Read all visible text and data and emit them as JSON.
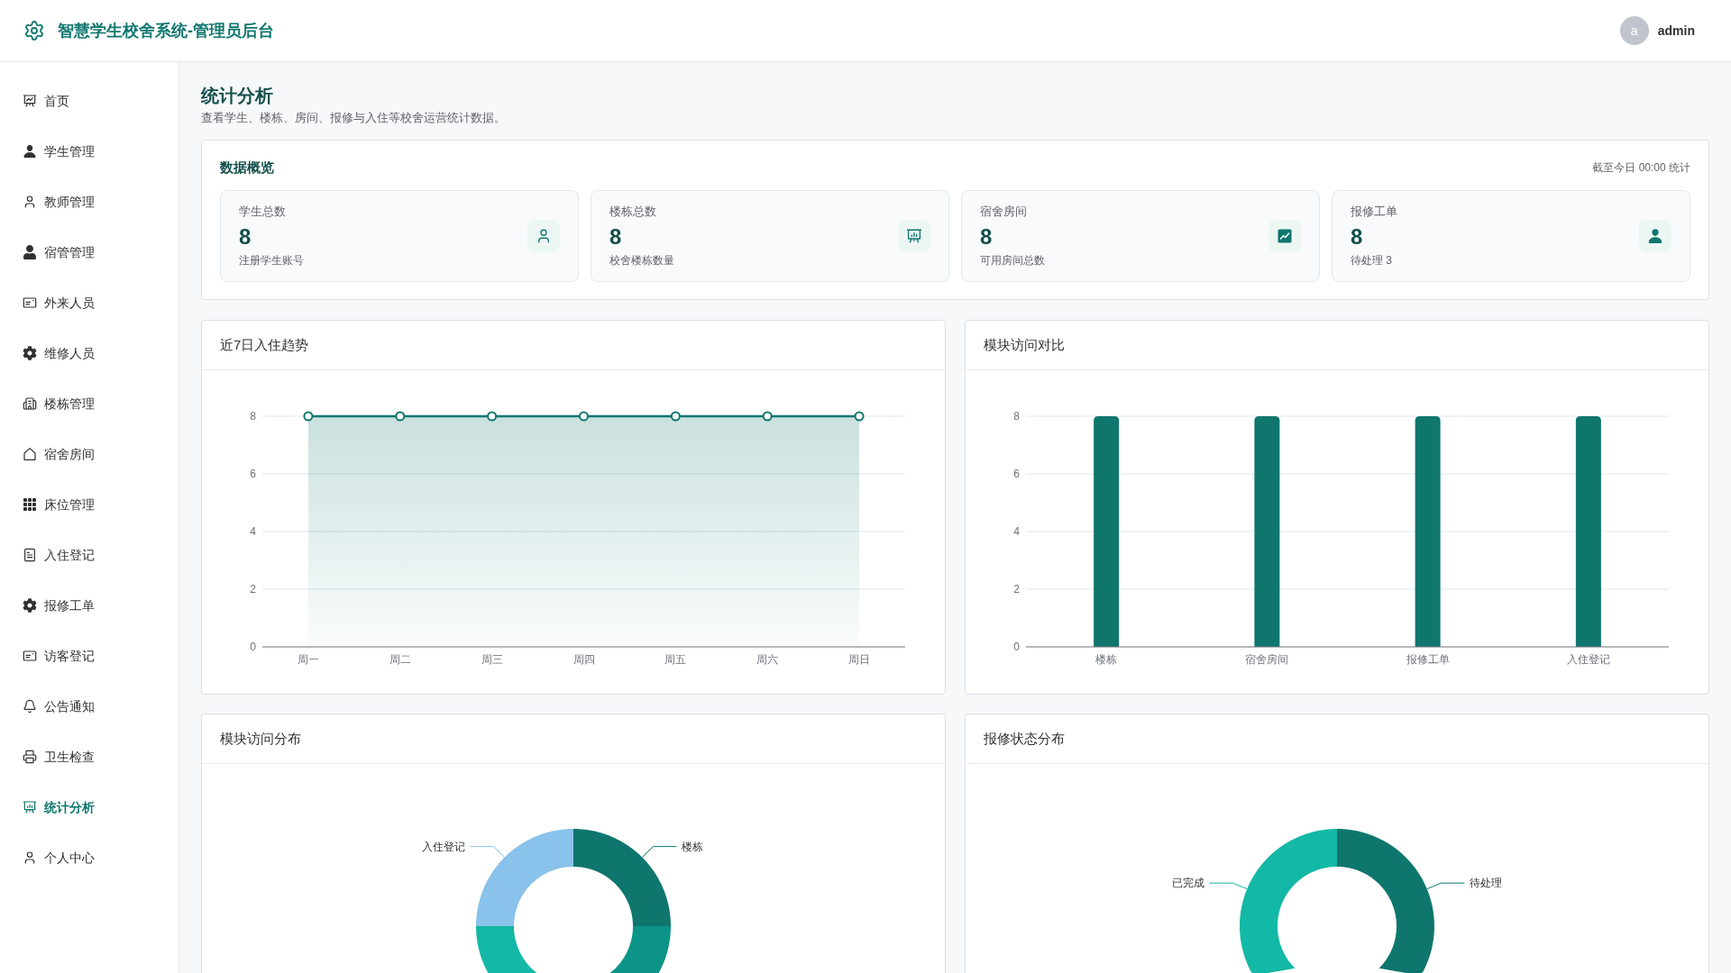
{
  "header": {
    "title": "智慧学生校舍系统-管理员后台",
    "user": {
      "avatar_letter": "a",
      "name": "admin"
    }
  },
  "sidebar": {
    "items": [
      {
        "label": "首页",
        "selected": false
      },
      {
        "label": "学生管理",
        "selected": false
      },
      {
        "label": "教师管理",
        "selected": false
      },
      {
        "label": "宿管管理",
        "selected": false
      },
      {
        "label": "外来人员",
        "selected": false
      },
      {
        "label": "维修人员",
        "selected": false
      },
      {
        "label": "楼栋管理",
        "selected": false
      },
      {
        "label": "宿舍房间",
        "selected": false
      },
      {
        "label": "床位管理",
        "selected": false
      },
      {
        "label": "入住登记",
        "selected": false
      },
      {
        "label": "报修工单",
        "selected": false
      },
      {
        "label": "访客登记",
        "selected": false
      },
      {
        "label": "公告通知",
        "selected": false
      },
      {
        "label": "卫生检查",
        "selected": false
      },
      {
        "label": "统计分析",
        "selected": true
      },
      {
        "label": "个人中心",
        "selected": false
      }
    ]
  },
  "page": {
    "title": "统计分析",
    "subtitle": "查看学生、楼栋、房间、报修与入住等校舍运营统计数据。"
  },
  "overview": {
    "title": "数据概览",
    "note": "截至今日 00:00 统计",
    "stats": [
      {
        "label": "学生总数",
        "value": "8",
        "note": "注册学生账号"
      },
      {
        "label": "楼栋总数",
        "value": "8",
        "note": "校舍楼栋数量"
      },
      {
        "label": "宿舍房间",
        "value": "8",
        "note": "可用房间总数"
      },
      {
        "label": "报修工单",
        "value": "8",
        "note": "待处理 3"
      }
    ]
  },
  "trend_chart": {
    "title": "近7日入住趋势",
    "chart_data": {
      "type": "area",
      "categories": [
        "周一",
        "周二",
        "周三",
        "周四",
        "周五",
        "周六",
        "周日"
      ],
      "series": [
        {
          "color": "#0f766e",
          "values": [
            8,
            8,
            8,
            8,
            8,
            8,
            8
          ]
        }
      ],
      "ylim": [
        0,
        8
      ],
      "yticks": [
        0,
        2,
        4,
        6,
        8
      ],
      "grid": true
    }
  },
  "module_chart": {
    "title": "模块访问对比",
    "chart_data": {
      "type": "bar",
      "categories": [
        "楼栋",
        "宿舍房间",
        "报修工单",
        "入住登记"
      ],
      "series": [
        {
          "color": "#0f766e",
          "values": [
            8,
            8,
            8,
            8
          ]
        }
      ],
      "ylim": [
        0,
        8
      ],
      "yticks": [
        0,
        2,
        4,
        6,
        8
      ],
      "grid": true
    }
  },
  "module_share": {
    "title": "模块访问分布",
    "slices": [
      {
        "label": "入住登记",
        "color": "#89c2ea"
      },
      {
        "color": "#14b8a6"
      },
      {
        "color": "#0d9488"
      },
      {
        "label": "楼栋",
        "color": "#0f766e"
      }
    ]
  },
  "repair_status": {
    "title": "报修状态分布",
    "slices": [
      {
        "label": "已完成",
        "color": "#14b8a6"
      },
      {
        "label": "待处理",
        "color": "#0f766e"
      }
    ]
  }
}
